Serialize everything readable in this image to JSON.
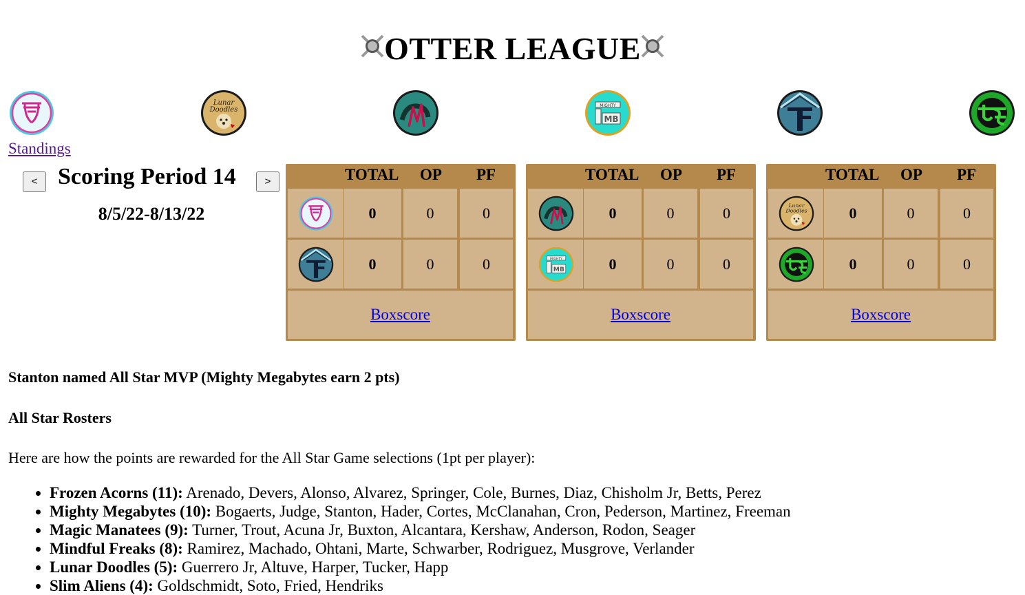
{
  "header": {
    "title": "OTTER LEAGUE",
    "emblem_left": "crossed-bats-baseball-icon",
    "emblem_right": "crossed-bats-baseball-icon"
  },
  "team_logos": [
    {
      "team": "Frozen Acorns",
      "icon": "frozen-acorns-logo"
    },
    {
      "team": "Lunar Doodles",
      "icon": "lunar-doodles-logo",
      "text": "Lunar Doodles"
    },
    {
      "team": "Magic Manatees",
      "icon": "magic-manatees-logo"
    },
    {
      "team": "Mighty Megabytes",
      "icon": "mighty-megabytes-logo"
    },
    {
      "team": "Mindful Freaks",
      "icon": "mindful-freaks-logo"
    },
    {
      "team": "Slim Aliens",
      "icon": "slim-aliens-logo"
    }
  ],
  "standings_link": "Standings",
  "scoring_period": {
    "prev": "<",
    "next": ">",
    "title": "Scoring Period 14",
    "dates": "8/5/22-8/13/22"
  },
  "matchup_headers": {
    "total": "TOTAL",
    "op": "OP",
    "pf": "PF"
  },
  "matchups": [
    {
      "rows": [
        {
          "team": "Frozen Acorns",
          "total": "0",
          "op": "0",
          "pf": "0"
        },
        {
          "team": "Mindful Freaks",
          "total": "0",
          "op": "0",
          "pf": "0"
        }
      ],
      "link": "Boxscore"
    },
    {
      "rows": [
        {
          "team": "Magic Manatees",
          "total": "0",
          "op": "0",
          "pf": "0"
        },
        {
          "team": "Mighty Megabytes",
          "total": "0",
          "op": "0",
          "pf": "0"
        }
      ],
      "link": "Boxscore"
    },
    {
      "rows": [
        {
          "team": "Lunar Doodles",
          "total": "0",
          "op": "0",
          "pf": "0"
        },
        {
          "team": "Slim Aliens",
          "total": "0",
          "op": "0",
          "pf": "0"
        }
      ],
      "link": "Boxscore"
    }
  ],
  "news": {
    "headline": "Stanton named All Star MVP (Mighty Megabytes earn 2 pts)",
    "section_title": "All Star Rosters",
    "intro": "Here are how the points are rewarded for the All Star Game selections (1pt per player):",
    "rosters": [
      {
        "team": "Frozen Acorns (11):",
        "players": "Arenado, Devers, Alonso, Alvarez, Springer, Cole, Burnes, Diaz, Chisholm Jr, Betts, Perez"
      },
      {
        "team": "Mighty Megabytes (10):",
        "players": "Bogaerts, Judge, Stanton, Hader, Cortes, McClanahan, Cron, Pederson, Martinez, Freeman"
      },
      {
        "team": "Magic Manatees (9):",
        "players": "Turner, Trout, Acuna Jr, Buxton, Alcantara, Kershaw, Anderson, Rodon, Seager"
      },
      {
        "team": "Mindful Freaks (8):",
        "players": "Ramirez, Machado, Ohtani, Marte, Schwarber, Rodriguez, Musgrove, Verlander"
      },
      {
        "team": "Lunar Doodles (5):",
        "players": "Guerrero Jr, Altuve, Harper, Tucker, Happ"
      },
      {
        "team": "Slim Aliens (4):",
        "players": "Goldschmidt, Soto, Fried, Hendriks"
      }
    ]
  },
  "colors": {
    "matchup_border": "#b5894c",
    "matchup_cell": "#d2b48c",
    "link": "#0000ee",
    "visited_link": "#551a8b"
  }
}
